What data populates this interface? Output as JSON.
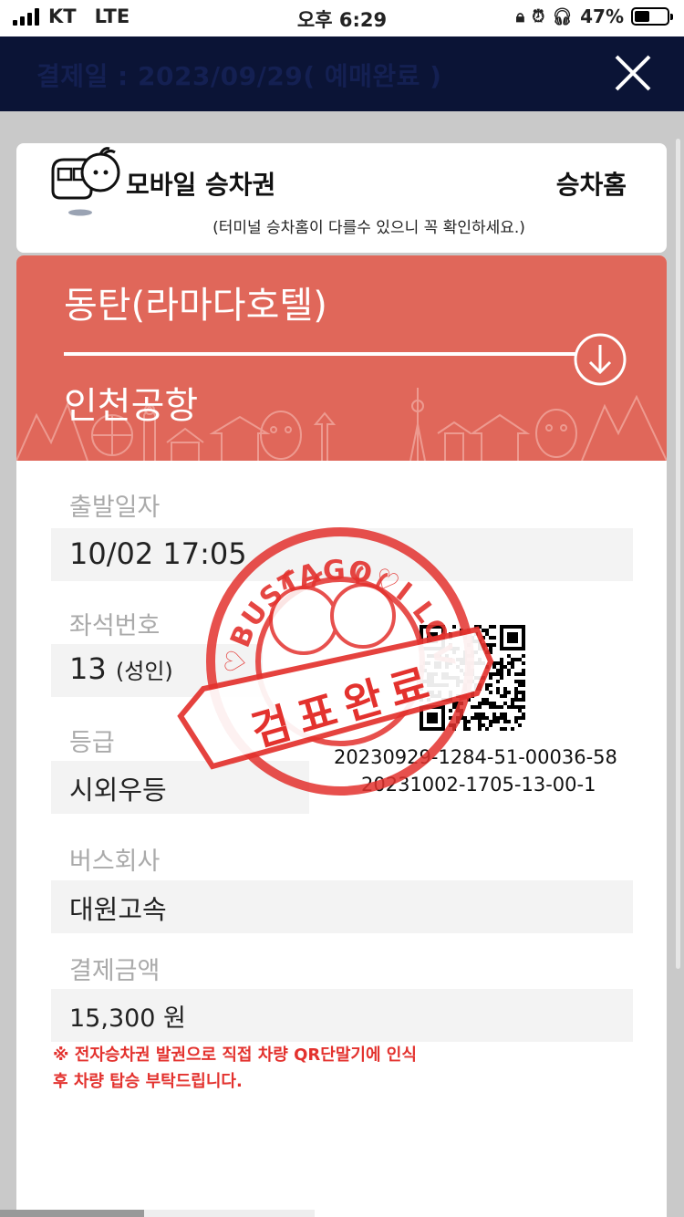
{
  "status_bar": {
    "carrier": "KT",
    "network": "LTE",
    "time": "오후 6:29",
    "battery": "47%",
    "battery_level": 0.47
  },
  "header": {
    "title": "결제일 : 2023/09/29( 예매완료 )"
  },
  "ticket_card": {
    "title": "모바일 승차권",
    "platform_label": "승차홈",
    "platform_notice": "(터미널 승차홈이 다를수 있으니 꼭 확인하세요.)"
  },
  "route": {
    "origin": "동탄(라마다호텔)",
    "destination": "인천공항"
  },
  "details": {
    "departure_label": "출발일자",
    "departure_value": "10/02 17:05",
    "seat_label": "좌석번호",
    "seat_value": "13",
    "seat_type": "(성인)",
    "grade_label": "등급",
    "grade_value": "시외우등",
    "company_label": "버스회사",
    "company_value": "대원고속",
    "price_label": "결제금액",
    "price_value": "15,300 원"
  },
  "qr": {
    "code_line1": "20230929-1284-51-00036-58",
    "code_line2": "20231002-1705-13-00-1"
  },
  "stamp": {
    "ring_text": "♡BUSTAGO♡I LOVE♡BUSTAGO♡",
    "ribbon_text": "검표완료"
  },
  "warning": {
    "line1": "※ 전자승차권 발권으로 직접 차량 QR단말기에 인식",
    "line2": "후 차량 탑승 부탁드립니다."
  },
  "colors": {
    "header_bg": "#0b1436",
    "banner": "#e0675a",
    "stamp": "#e3322e",
    "warning": "#e3322e"
  }
}
